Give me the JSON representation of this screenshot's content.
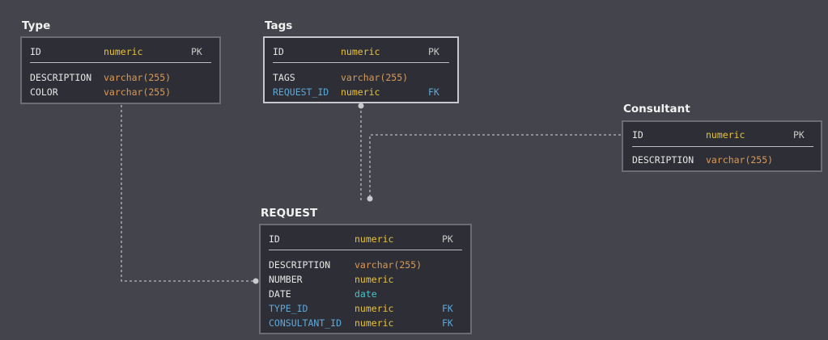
{
  "diagram": {
    "entities": {
      "type": {
        "title": "Type",
        "pk_row": {
          "name": "ID",
          "type": "numeric",
          "key": "PK"
        },
        "rows": [
          {
            "name": "DESCRIPTION",
            "type": "varchar(255)",
            "key": ""
          },
          {
            "name": "COLOR",
            "type": "varchar(255)",
            "key": ""
          }
        ]
      },
      "tags": {
        "title": "Tags",
        "pk_row": {
          "name": "ID",
          "type": "numeric",
          "key": "PK"
        },
        "rows": [
          {
            "name": "TAGS",
            "type": "varchar(255)",
            "key": ""
          },
          {
            "name": "REQUEST_ID",
            "type": "numeric",
            "key": "FK"
          }
        ]
      },
      "consultant": {
        "title": "Consultant",
        "pk_row": {
          "name": "ID",
          "type": "numeric",
          "key": "PK"
        },
        "rows": [
          {
            "name": "DESCRIPTION",
            "type": "varchar(255)",
            "key": ""
          }
        ]
      },
      "request": {
        "title": "REQUEST",
        "pk_row": {
          "name": "ID",
          "type": "numeric",
          "key": "PK"
        },
        "rows": [
          {
            "name": "DESCRIPTION",
            "type": "varchar(255)",
            "key": ""
          },
          {
            "name": "NUMBER",
            "type": "numeric",
            "key": ""
          },
          {
            "name": "DATE",
            "type": "date",
            "key": ""
          },
          {
            "name": "TYPE_ID",
            "type": "numeric",
            "key": "FK"
          },
          {
            "name": "CONSULTANT_ID",
            "type": "numeric",
            "key": "FK"
          }
        ]
      }
    },
    "relationships": [
      {
        "from": "type",
        "to": "request"
      },
      {
        "from": "tags",
        "to": "request"
      },
      {
        "from": "consultant",
        "to": "request"
      }
    ],
    "colors": {
      "background": "#44444c",
      "table_bg": "#2e2f36",
      "border": "#6c6d74",
      "selected_border": "#c7c8ce",
      "numeric": "#e7c23a",
      "varchar": "#d89a5a",
      "date": "#4ec1c8",
      "fk": "#5ea8d8",
      "connector": "#b9b9bf"
    }
  }
}
